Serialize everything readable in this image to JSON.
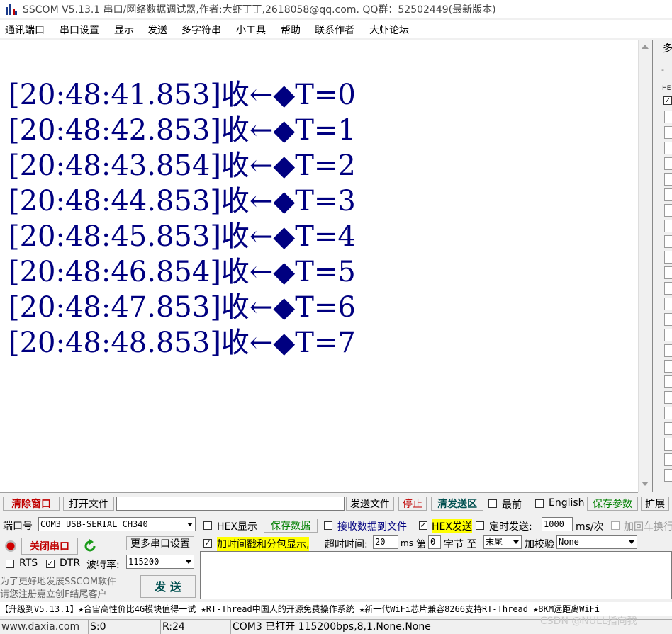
{
  "window": {
    "title": "SSCOM V5.13.1 串口/网络数据调试器,作者:大虾丁丁,2618058@qq.com. QQ群：52502449(最新版本)"
  },
  "menu": [
    "通讯端口",
    "串口设置",
    "显示",
    "发送",
    "多字符串",
    "小工具",
    "帮助",
    "联系作者",
    "大虾论坛"
  ],
  "receive": {
    "lines": [
      "[20:48:41.853]收←◆T=0",
      "[20:48:42.853]收←◆T=1",
      "[20:48:43.854]收←◆T=2",
      "[20:48:44.853]收←◆T=3",
      "[20:48:45.853]收←◆T=4",
      "[20:48:46.854]收←◆T=5",
      "[20:48:47.853]收←◆T=6",
      "[20:48:48.853]收←◆T=7"
    ]
  },
  "right_panel": {
    "tab_label": "多",
    "tab_label2": "-",
    "hex_label": "HE"
  },
  "toolbar1": {
    "clear_window": "清除窗口",
    "open_file": "打开文件",
    "send_file": "发送文件",
    "stop": "停止",
    "clear_send": "清发送区",
    "most_front": "最前",
    "english": "English",
    "save_params": "保存参数",
    "expand": "扩展"
  },
  "port": {
    "label": "端口号",
    "value": "COM3 USB-SERIAL CH340",
    "close_button": "关闭串口",
    "more_settings": "更多串口设置",
    "rts": "RTS",
    "dtr": "DTR",
    "baud_label": "波特率:",
    "baud_value": "115200",
    "promo_line1": "为了更好地发展SSCOM软件",
    "promo_line2": "请您注册嘉立创F结尾客户",
    "send_button": "发 送"
  },
  "options": {
    "hex_display": "HEX显示",
    "save_data": "保存数据",
    "recv_to_file": "接收数据到文件",
    "hex_send": "HEX发送",
    "timed_send": "定时发送:",
    "interval_value": "1000",
    "interval_unit": "ms/次",
    "add_crlf": "加回车换行",
    "timestamp": "加时间戳和分包显示,",
    "timeout_label": "超时时间:",
    "timeout_value": "20",
    "timeout_unit": "ms",
    "byte_prefix": "第",
    "byte_index": "0",
    "byte_suffix": "字节 至",
    "end_value": "末尾",
    "checksum_label": "加校验",
    "checksum_value": "None"
  },
  "ticker": "【升级到V5.13.1】★合宙高性价比4G模块值得一试 ★RT-Thread中国人的开源免费操作系统 ★新一代WiFi芯片兼容8266支持RT-Thread ★8KM远距离WiFi",
  "status": {
    "website": "www.daxia.com",
    "sent": "S:0",
    "received": "R:24",
    "port_state": "COM3 已打开  115200bps,8,1,None,None"
  },
  "watermark": "CSDN @NULL指向我",
  "colors": {
    "rx_text": "#000080",
    "highlight": "#ffff00"
  }
}
